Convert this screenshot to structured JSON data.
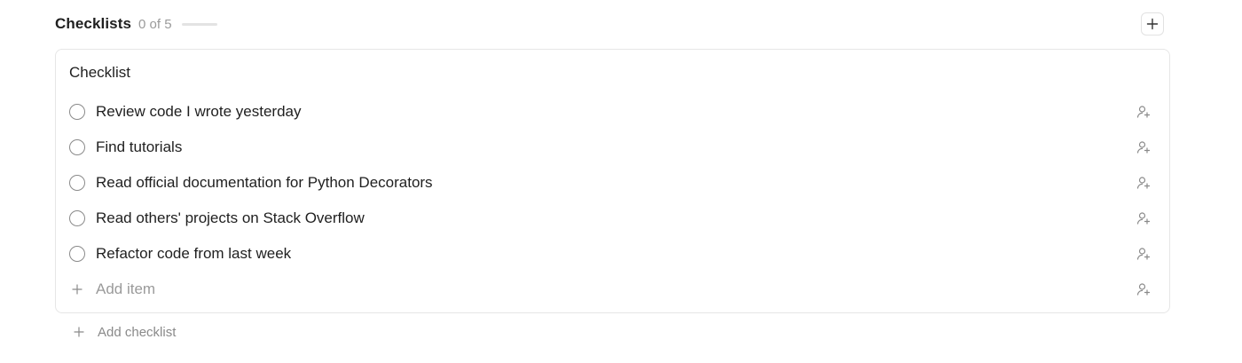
{
  "header": {
    "title": "Checklists",
    "count_text": "0 of 5",
    "progress": 0,
    "add_icon": "plus-icon"
  },
  "checklist": {
    "title": "Checklist",
    "items": [
      {
        "label": "Review code I wrote yesterday",
        "checked": false,
        "icon": "assign-user-icon"
      },
      {
        "label": "Find tutorials",
        "checked": false,
        "icon": "assign-user-icon"
      },
      {
        "label": "Read official documentation for Python Decorators",
        "checked": false,
        "icon": "assign-user-icon"
      },
      {
        "label": "Read others' projects on Stack Overflow",
        "checked": false,
        "icon": "assign-user-icon"
      },
      {
        "label": "Refactor code from last week",
        "checked": false,
        "icon": "assign-user-icon"
      }
    ],
    "add_item_label": "Add item"
  },
  "add_checklist_label": "Add checklist",
  "colors": {
    "text": "#1f1f1f",
    "muted": "#9a9a9a",
    "border": "#e6e6e6"
  }
}
